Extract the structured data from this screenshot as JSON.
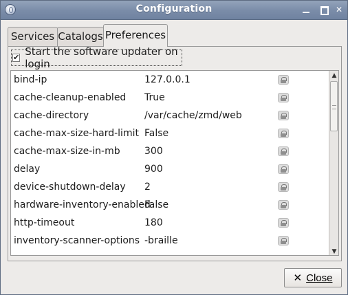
{
  "window": {
    "title": "Configuration"
  },
  "tabs": [
    {
      "label": "Services"
    },
    {
      "label": "Catalogs"
    },
    {
      "label": "Preferences"
    }
  ],
  "checkbox": {
    "label": "Start the software updater on login",
    "checked": true,
    "mark": "✔"
  },
  "preferences": [
    {
      "key": "bind-ip",
      "value": "127.0.0.1"
    },
    {
      "key": "cache-cleanup-enabled",
      "value": "True"
    },
    {
      "key": "cache-directory",
      "value": "/var/cache/zmd/web"
    },
    {
      "key": "cache-max-size-hard-limit",
      "value": "False"
    },
    {
      "key": "cache-max-size-in-mb",
      "value": "300"
    },
    {
      "key": "delay",
      "value": "900"
    },
    {
      "key": "device-shutdown-delay",
      "value": "2"
    },
    {
      "key": "hardware-inventory-enabled",
      "value": "False"
    },
    {
      "key": "http-timeout",
      "value": "180"
    },
    {
      "key": "inventory-scanner-options",
      "value": "-braille"
    }
  ],
  "buttons": {
    "close_label": "Close",
    "close_icon": "✕"
  }
}
